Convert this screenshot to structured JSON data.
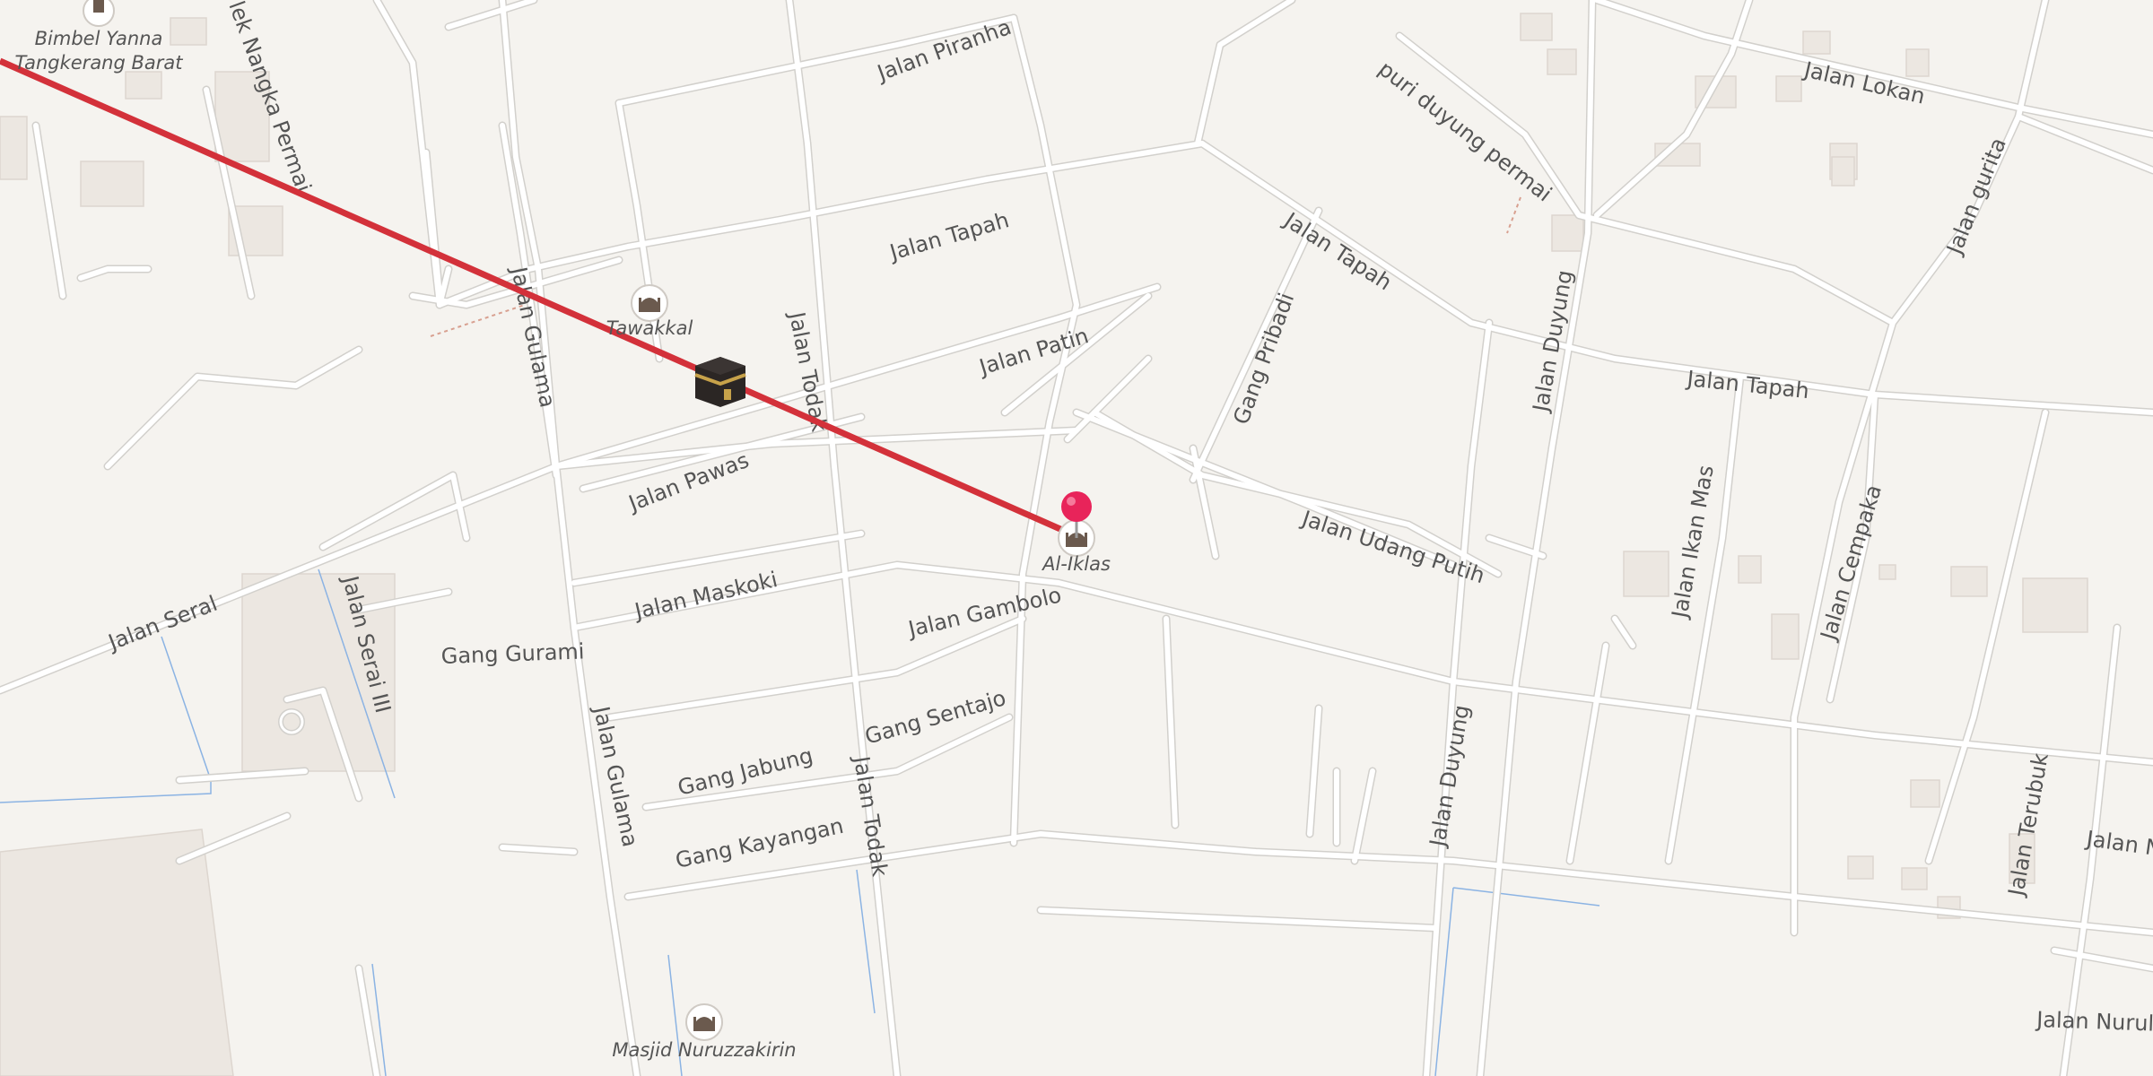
{
  "map": {
    "streets": [
      "Jalan Piranha",
      "Jalan Tapah",
      "Jalan Tapah",
      "Jalan Tapah",
      "Jalan Patin",
      "Jalan Pawas",
      "Jalan Maskoki",
      "Jalan Gambolo",
      "Gang Sentajo",
      "Gang Jabung",
      "Gang Kayangan",
      "Jalan Seral",
      "Gang Gurami",
      "Jalan Serai III",
      "Jalan Gulama",
      "Jalan Gulama",
      "Jalan Todak",
      "Jalan Todak",
      "Gang Pribadi",
      "Jalan Udang Putih",
      "Jalan Duyung",
      "Jalan Duyung",
      "puri duyung permai",
      "Jalan Lokan",
      "Jalan gurita",
      "Jalan Ikan Mas",
      "Jalan Cempaka",
      "Jalan Terubuk",
      "Jalan N",
      "Jalan Nurul",
      "lek Nangka Permai"
    ],
    "pois": [
      {
        "name": "Bimbel Yanna Tangkerang Barat",
        "lines": [
          "Bimbel Yanna",
          "Tangkerang Barat"
        ],
        "icon": "school-icon"
      },
      {
        "name": "Tawakkal",
        "icon": "mosque-icon"
      },
      {
        "name": "Al-Iklas",
        "icon": "mosque-icon"
      },
      {
        "name": "Masjid Nuruzzakirin",
        "icon": "mosque-icon"
      }
    ],
    "qibla": {
      "icon": "kaaba-icon",
      "line_color": "#d3313a"
    },
    "marker": {
      "icon": "location-pin-icon",
      "color": "#e8245a"
    },
    "colors": {
      "background": "#f5f3ef",
      "road": "#ffffff",
      "road_casing": "#d2d0cc",
      "building": "#ece7e1",
      "water": "#8bb3e3"
    }
  }
}
